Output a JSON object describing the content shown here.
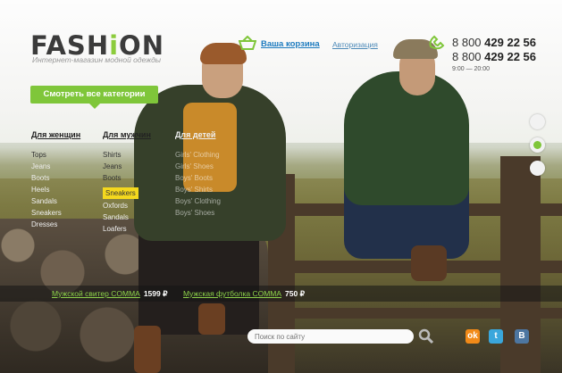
{
  "header": {
    "logo_prefix": "FASH",
    "logo_accent": "i",
    "logo_suffix": "ON",
    "tagline": "Интернет-магазин модной одежды",
    "cart_label": "Ваша корзина",
    "auth_label": "Авторизация",
    "phones": [
      {
        "code": "8 800",
        "number": "429 22 56"
      },
      {
        "code": "8 800",
        "number": "429 22 56"
      }
    ],
    "hours": "9:00 — 20:00"
  },
  "catalog": {
    "all_categories_label": "Смотреть все категории",
    "columns": [
      {
        "title": "Для женщин",
        "items": [
          "Tops",
          "Jeans",
          "Boots",
          "Heels",
          "Sandals",
          "Sneakers",
          "Dresses"
        ]
      },
      {
        "title": "Для мужчин",
        "items": [
          "Shirts",
          "Jeans",
          "Boots",
          "Sneakers",
          "Oxfords",
          "Sandals",
          "Loafers"
        ],
        "highlighted": "Sneakers"
      },
      {
        "title": "Для детей",
        "items": [
          "Girls' Clothing",
          "Girls' Shoes",
          "Boys' Boots",
          "Boys' Shirts",
          "Boys' Clothing",
          "Boys' Shoes"
        ]
      }
    ]
  },
  "slider": {
    "dots": 3,
    "active_index": 1
  },
  "promos": [
    {
      "name": "Мужской свитер COMMA",
      "price": "1599 ₽"
    },
    {
      "name": "Мужская футболка COMMA",
      "price": "750 ₽"
    }
  ],
  "search": {
    "placeholder": "Поиск по сайту"
  },
  "social": [
    {
      "name": "odnoklassniki-icon",
      "glyph": "ok",
      "color": "#f28a18"
    },
    {
      "name": "twitter-icon",
      "glyph": "t",
      "color": "#3aa7dc"
    },
    {
      "name": "vkontakte-icon",
      "glyph": "B",
      "color": "#4d76a1"
    }
  ],
  "colors": {
    "accent": "#7fc63a",
    "link": "#1d7bbf",
    "highlight": "#f4d81e"
  }
}
